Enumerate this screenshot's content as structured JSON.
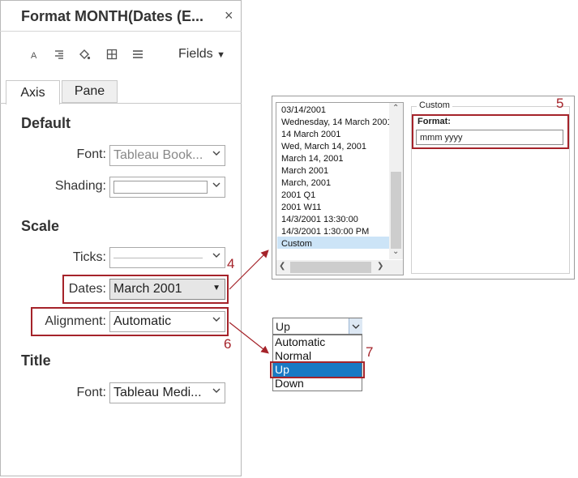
{
  "pane": {
    "title": "Format MONTH(Dates (E...",
    "close": "×",
    "fields_label": "Fields",
    "tabs": [
      "Axis",
      "Pane"
    ],
    "default": {
      "heading": "Default",
      "font_label": "Font:",
      "font_value": "Tableau Book...",
      "shading_label": "Shading:"
    },
    "scale": {
      "heading": "Scale",
      "ticks_label": "Ticks:",
      "dates_label": "Dates:",
      "dates_value": "March 2001",
      "alignment_label": "Alignment:",
      "alignment_value": "Automatic"
    },
    "title_section": {
      "heading": "Title",
      "font_label": "Font:",
      "font_value": "Tableau Medi..."
    }
  },
  "date_formats": {
    "items": [
      "03/14/2001",
      "Wednesday, 14 March 2001",
      "14 March 2001",
      "Wed, March 14, 2001",
      "March 14, 2001",
      "March 2001",
      "March, 2001",
      "2001 Q1",
      "2001 W11",
      "14/3/2001 13:30:00",
      "14/3/2001 1:30:00 PM",
      "Custom"
    ],
    "selected": "Custom",
    "custom_group_title": "Custom",
    "format_label": "Format:",
    "format_value": "mmm yyyy"
  },
  "alignment_popup": {
    "current": "Up",
    "options": [
      "Automatic",
      "Normal",
      "Up",
      "Down"
    ],
    "highlighted": "Up"
  },
  "callouts": {
    "n4": "4",
    "n5": "5",
    "n6": "6",
    "n7": "7"
  },
  "colors": {
    "callout_red": "#a5232a",
    "selection_blue": "#1979c4",
    "list_selection": "#cce4f7"
  }
}
